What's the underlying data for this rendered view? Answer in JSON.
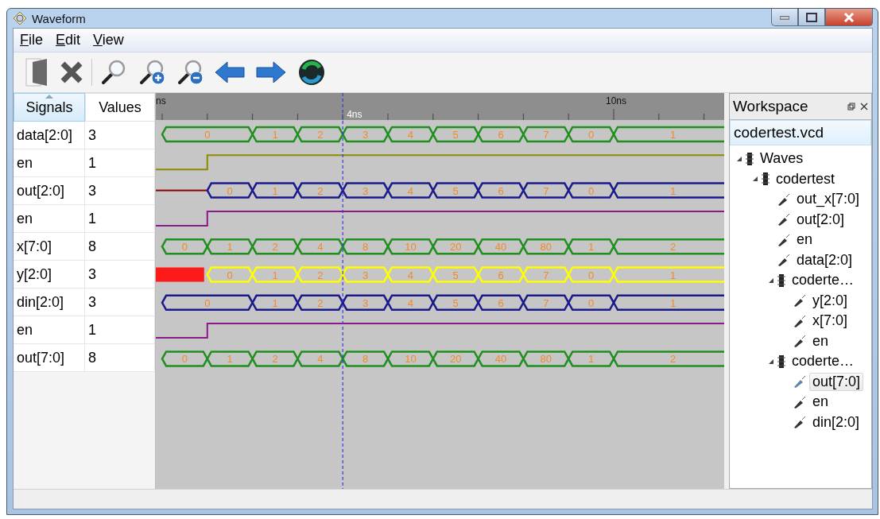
{
  "window": {
    "title": "Waveform"
  },
  "menu": [
    "File",
    "Edit",
    "View"
  ],
  "signals_table": {
    "columns": [
      {
        "label": "Signals",
        "sorted": true
      },
      {
        "label": "Values",
        "sorted": false
      }
    ],
    "rows": [
      {
        "signal": "data[2:0]",
        "value": "3"
      },
      {
        "signal": "en",
        "value": "1"
      },
      {
        "signal": "out[2:0]",
        "value": "3"
      },
      {
        "signal": "en",
        "value": "1"
      },
      {
        "signal": "x[7:0]",
        "value": "8"
      },
      {
        "signal": "y[2:0]",
        "value": "3"
      },
      {
        "signal": "din[2:0]",
        "value": "3"
      },
      {
        "signal": "en",
        "value": "1"
      },
      {
        "signal": "out[7:0]",
        "value": "8"
      }
    ]
  },
  "timeline": {
    "start_label": "ns",
    "major_label": "10ns",
    "cursor_label": "4ns"
  },
  "waves": [
    {
      "color": "#1f8f1f",
      "segments": [
        {
          "kind": "bus",
          "wide": true,
          "label": "0"
        },
        {
          "kind": "bus",
          "wide": false,
          "label": "1"
        },
        {
          "kind": "bus",
          "wide": false,
          "label": "2"
        },
        {
          "kind": "bus",
          "wide": false,
          "label": "3"
        },
        {
          "kind": "bus",
          "wide": false,
          "label": "4"
        },
        {
          "kind": "bus",
          "wide": false,
          "label": "5"
        },
        {
          "kind": "bus",
          "wide": false,
          "label": "6"
        },
        {
          "kind": "bus",
          "wide": false,
          "label": "7"
        },
        {
          "kind": "bus",
          "wide": false,
          "label": "0"
        },
        {
          "kind": "bus",
          "label": "1"
        }
      ]
    },
    {
      "color": "#8c8c00",
      "segments": [
        {
          "kind": "low",
          "wide": false
        },
        {
          "kind": "high"
        }
      ]
    },
    {
      "color": "#1a1a8c",
      "segments": [
        {
          "kind": "floating",
          "wide": false
        },
        {
          "kind": "bus",
          "wide": false,
          "label": "0"
        },
        {
          "kind": "bus",
          "wide": false,
          "label": "1"
        },
        {
          "kind": "bus",
          "wide": false,
          "label": "2"
        },
        {
          "kind": "bus",
          "wide": false,
          "label": "3"
        },
        {
          "kind": "bus",
          "wide": false,
          "label": "4"
        },
        {
          "kind": "bus",
          "wide": false,
          "label": "5"
        },
        {
          "kind": "bus",
          "wide": false,
          "label": "6"
        },
        {
          "kind": "bus",
          "wide": false,
          "label": "7"
        },
        {
          "kind": "bus",
          "wide": false,
          "label": "0"
        },
        {
          "kind": "bus",
          "label": "1"
        }
      ]
    },
    {
      "color": "#8c1a8c",
      "segments": [
        {
          "kind": "low",
          "wide": false
        },
        {
          "kind": "high"
        }
      ]
    },
    {
      "color": "#1f8f1f",
      "segments": [
        {
          "kind": "bus",
          "wide": false,
          "label": "0"
        },
        {
          "kind": "bus",
          "wide": false,
          "label": "1"
        },
        {
          "kind": "bus",
          "wide": false,
          "label": "2"
        },
        {
          "kind": "bus",
          "wide": false,
          "label": "4"
        },
        {
          "kind": "bus",
          "wide": false,
          "label": "8"
        },
        {
          "kind": "bus",
          "wide": false,
          "label": "10"
        },
        {
          "kind": "bus",
          "wide": false,
          "label": "20"
        },
        {
          "kind": "bus",
          "wide": false,
          "label": "40"
        },
        {
          "kind": "bus",
          "wide": false,
          "label": "80"
        },
        {
          "kind": "bus",
          "wide": false,
          "label": "1"
        },
        {
          "kind": "bus",
          "label": "2"
        }
      ]
    },
    {
      "color": "#ffff00",
      "segments": [
        {
          "kind": "unknown",
          "wide": false
        },
        {
          "kind": "bus",
          "wide": false,
          "label": "0"
        },
        {
          "kind": "bus",
          "wide": false,
          "label": "1"
        },
        {
          "kind": "bus",
          "wide": false,
          "label": "2"
        },
        {
          "kind": "bus",
          "wide": false,
          "label": "3"
        },
        {
          "kind": "bus",
          "wide": false,
          "label": "4"
        },
        {
          "kind": "bus",
          "wide": false,
          "label": "5"
        },
        {
          "kind": "bus",
          "wide": false,
          "label": "6"
        },
        {
          "kind": "bus",
          "wide": false,
          "label": "7"
        },
        {
          "kind": "bus",
          "wide": false,
          "label": "0"
        },
        {
          "kind": "bus",
          "label": "1"
        }
      ]
    },
    {
      "color": "#1a1a8c",
      "segments": [
        {
          "kind": "bus",
          "wide": true,
          "label": "0"
        },
        {
          "kind": "bus",
          "wide": false,
          "label": "1"
        },
        {
          "kind": "bus",
          "wide": false,
          "label": "2"
        },
        {
          "kind": "bus",
          "wide": false,
          "label": "3"
        },
        {
          "kind": "bus",
          "wide": false,
          "label": "4"
        },
        {
          "kind": "bus",
          "wide": false,
          "label": "5"
        },
        {
          "kind": "bus",
          "wide": false,
          "label": "6"
        },
        {
          "kind": "bus",
          "wide": false,
          "label": "7"
        },
        {
          "kind": "bus",
          "wide": false,
          "label": "0"
        },
        {
          "kind": "bus",
          "label": "1"
        }
      ]
    },
    {
      "color": "#8c1a8c",
      "segments": [
        {
          "kind": "low",
          "wide": false
        },
        {
          "kind": "high"
        }
      ]
    },
    {
      "color": "#1f8f1f",
      "segments": [
        {
          "kind": "bus",
          "wide": false,
          "label": "0"
        },
        {
          "kind": "bus",
          "wide": false,
          "label": "1"
        },
        {
          "kind": "bus",
          "wide": false,
          "label": "2"
        },
        {
          "kind": "bus",
          "wide": false,
          "label": "4"
        },
        {
          "kind": "bus",
          "wide": false,
          "label": "8"
        },
        {
          "kind": "bus",
          "wide": false,
          "label": "10"
        },
        {
          "kind": "bus",
          "wide": false,
          "label": "20"
        },
        {
          "kind": "bus",
          "wide": false,
          "label": "40"
        },
        {
          "kind": "bus",
          "wide": false,
          "label": "80"
        },
        {
          "kind": "bus",
          "wide": false,
          "label": "1"
        },
        {
          "kind": "bus",
          "label": "2"
        }
      ]
    }
  ],
  "workspace": {
    "title": "Workspace",
    "file": "codertest.vcd",
    "tree": [
      {
        "label": "Waves",
        "kind": "module",
        "expanded": true,
        "children": [
          {
            "label": "codertest",
            "kind": "module",
            "expanded": true,
            "children": [
              {
                "label": "out_x[7:0]",
                "kind": "signal",
                "selected": false
              },
              {
                "label": "out[2:0]",
                "kind": "signal",
                "selected": false
              },
              {
                "label": "en",
                "kind": "signal",
                "selected": false
              },
              {
                "label": "data[2:0]",
                "kind": "signal",
                "selected": false
              },
              {
                "label": "coderte…",
                "kind": "module",
                "expanded": true,
                "children": [
                  {
                    "label": "y[2:0]",
                    "kind": "signal",
                    "selected": false
                  },
                  {
                    "label": "x[7:0]",
                    "kind": "signal",
                    "selected": false
                  },
                  {
                    "label": "en",
                    "kind": "signal",
                    "selected": false
                  }
                ]
              },
              {
                "label": "coderte…",
                "kind": "module",
                "expanded": true,
                "children": [
                  {
                    "label": "out[7:0]",
                    "kind": "signal",
                    "selected": true
                  },
                  {
                    "label": "en",
                    "kind": "signal",
                    "selected": false
                  },
                  {
                    "label": "din[2:0]",
                    "kind": "signal",
                    "selected": false
                  }
                ]
              }
            ]
          }
        ]
      }
    ]
  }
}
